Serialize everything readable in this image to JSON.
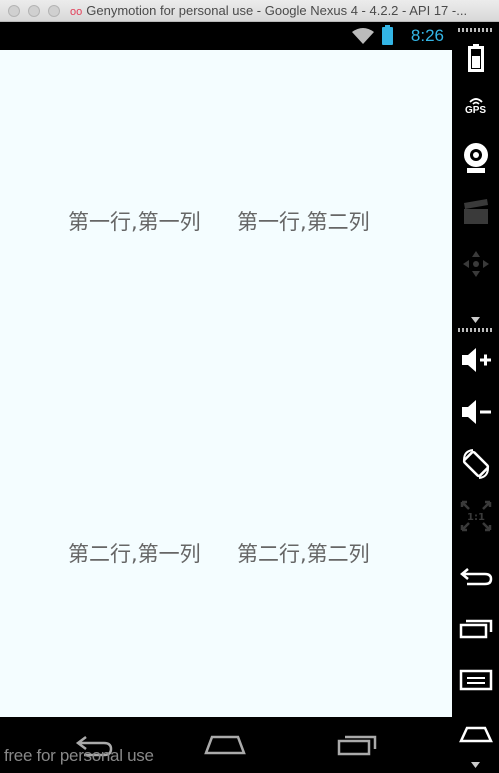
{
  "window": {
    "title": "Genymotion for personal use - Google Nexus 4 - 4.2.2 - API 17 -..."
  },
  "statusbar": {
    "time": "8:26"
  },
  "content": {
    "rows": [
      {
        "col1": "第一行,第一列",
        "col2": "第一行,第二列"
      },
      {
        "col1": "第二行,第一列",
        "col2": "第二行,第二列"
      }
    ]
  },
  "watermark": "free for personal use",
  "sidebar": {
    "gps_label": "GPS",
    "scale_label": "1:1"
  },
  "colors": {
    "accent": "#33b5e5",
    "content_bg": "#f4fdff",
    "text": "#666666"
  }
}
